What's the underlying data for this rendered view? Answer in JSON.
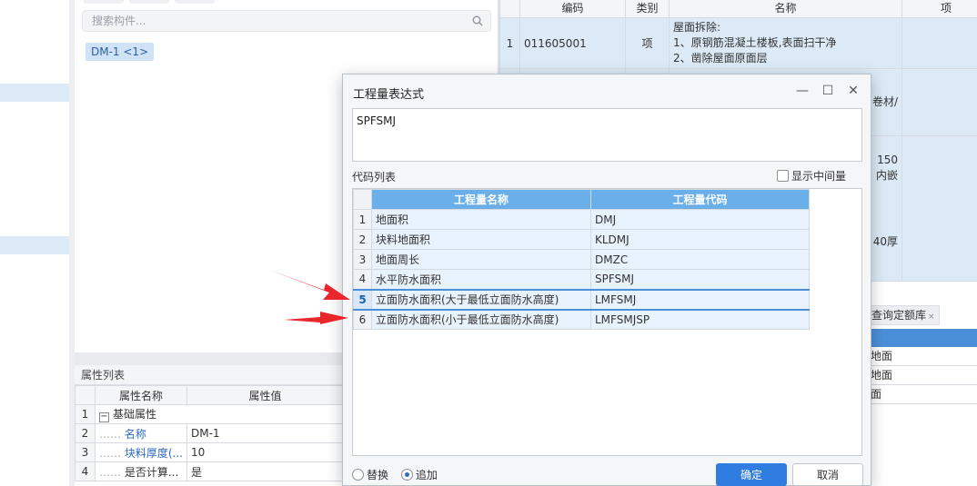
{
  "component_panel": {
    "search_placeholder": "搜索构件...",
    "component_tag": "DM-1 <1>"
  },
  "properties": {
    "title": "属性列表",
    "columns": [
      "属性名称",
      "属性值"
    ],
    "rows": [
      {
        "idx": "1",
        "name": "基础属性",
        "value": ""
      },
      {
        "idx": "2",
        "name": "名称",
        "value": "DM-1"
      },
      {
        "idx": "3",
        "name": "块料厚度(...",
        "value": "10"
      },
      {
        "idx": "4",
        "name": "是否计算...",
        "value": "是"
      }
    ]
  },
  "right_list": {
    "columns": [
      "编码",
      "类别",
      "名称",
      "项"
    ],
    "rows": [
      {
        "idx": "1",
        "code": "011605001",
        "type": "项",
        "name_lines": [
          "屋面拆除:",
          "1、原钢筋混凝土楼板,表面扫干净",
          "2、凿除屋面原面层"
        ],
        "extra": ""
      },
      {
        "idx": "",
        "code": "",
        "type": "",
        "name_lines": [
          "",
          "卷材/"
        ],
        "extra": ""
      },
      {
        "idx": "",
        "code": "",
        "type": "",
        "name_lines": [
          "150",
          "内嵌",
          "",
          "",
          "",
          "40厚"
        ],
        "extra": ""
      }
    ]
  },
  "quota": {
    "tab_label": "查询定额库",
    "close_label": "×",
    "rows": [
      "地面",
      "地面",
      "面"
    ]
  },
  "dialog": {
    "title": "工程量表达式",
    "minimize": "—",
    "maximize": "☐",
    "close": "✕",
    "expression": "SPFSMJ",
    "code_list_label": "代码列表",
    "show_intermediate_label": "显示中间量",
    "show_intermediate_checked": false,
    "columns": [
      "工程量名称",
      "工程量代码"
    ],
    "rows": [
      {
        "idx": "1",
        "name": "地面积",
        "code": "DMJ"
      },
      {
        "idx": "2",
        "name": "块料地面积",
        "code": "KLDMJ"
      },
      {
        "idx": "3",
        "name": "地面周长",
        "code": "DMZC"
      },
      {
        "idx": "4",
        "name": "水平防水面积",
        "code": "SPFSMJ"
      },
      {
        "idx": "5",
        "name": "立面防水面积(大于最低立面防水高度)",
        "code": "LMFSMJ"
      },
      {
        "idx": "6",
        "name": "立面防水面积(小于最低立面防水高度)",
        "code": "LMFSMJSP"
      }
    ],
    "active_row": "5",
    "mode_replace_label": "替换",
    "mode_append_label": "追加",
    "selected_mode": "追加",
    "ok_label": "确定",
    "cancel_label": "取消"
  },
  "colors": {
    "accent": "#2f7de1",
    "header_blue": "#6aaeea",
    "selection": "#dceaf7",
    "arrow_red": "#e8262b"
  }
}
